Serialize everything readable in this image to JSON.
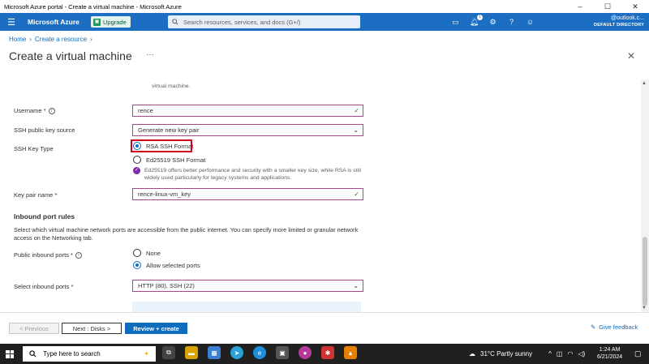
{
  "window": {
    "title": "Microsoft Azure portal - Create a virtual machine - Microsoft Azure",
    "controls": [
      "–",
      "☐",
      "✕"
    ]
  },
  "topbar": {
    "brand": "Microsoft Azure",
    "upgrade": "Upgrade",
    "search_placeholder": "Search resources, services, and docs (G+/)",
    "notification_count": "1",
    "account_email": "@outlook.c...",
    "directory": "DEFAULT DIRECTORY"
  },
  "breadcrumb": {
    "home": "Home",
    "create": "Create a resource"
  },
  "page": {
    "title": "Create a virtual machine",
    "more": "···"
  },
  "form": {
    "truncated_text": "virtual machine.",
    "username_label": "Username *",
    "username_value": "rence",
    "ssh_source_label": "SSH public key source",
    "ssh_source_value": "Generate new key pair",
    "ssh_type_label": "SSH Key Type",
    "ssh_type_options": [
      "RSA SSH Format",
      "Ed25519 SSH Format"
    ],
    "ssh_type_note": "Ed25519 offers better performance and security with a smaller key size, while RSA is still widely used particularly for legacy systems and applications.",
    "keypair_label": "Key pair name *",
    "keypair_value": "rence-linux-vm_key",
    "inbound_heading": "Inbound port rules",
    "inbound_desc": "Select which virtual machine network ports are accessible from the public internet. You can specify more limited or granular network access on the Networking tab.",
    "public_ports_label": "Public inbound ports *",
    "public_ports_options": [
      "None",
      "Allow selected ports"
    ],
    "select_ports_label": "Select inbound ports *",
    "select_ports_value": "HTTP (80), SSH (22)"
  },
  "footer": {
    "previous": "< Previous",
    "next": "Next : Disks >",
    "create": "Review + create",
    "feedback": "Give feedback"
  },
  "taskbar": {
    "search_placeholder": "Type here to search",
    "weather": "31°C  Partly sunny",
    "time": "1:24 AM",
    "date": "6/21/2024"
  }
}
